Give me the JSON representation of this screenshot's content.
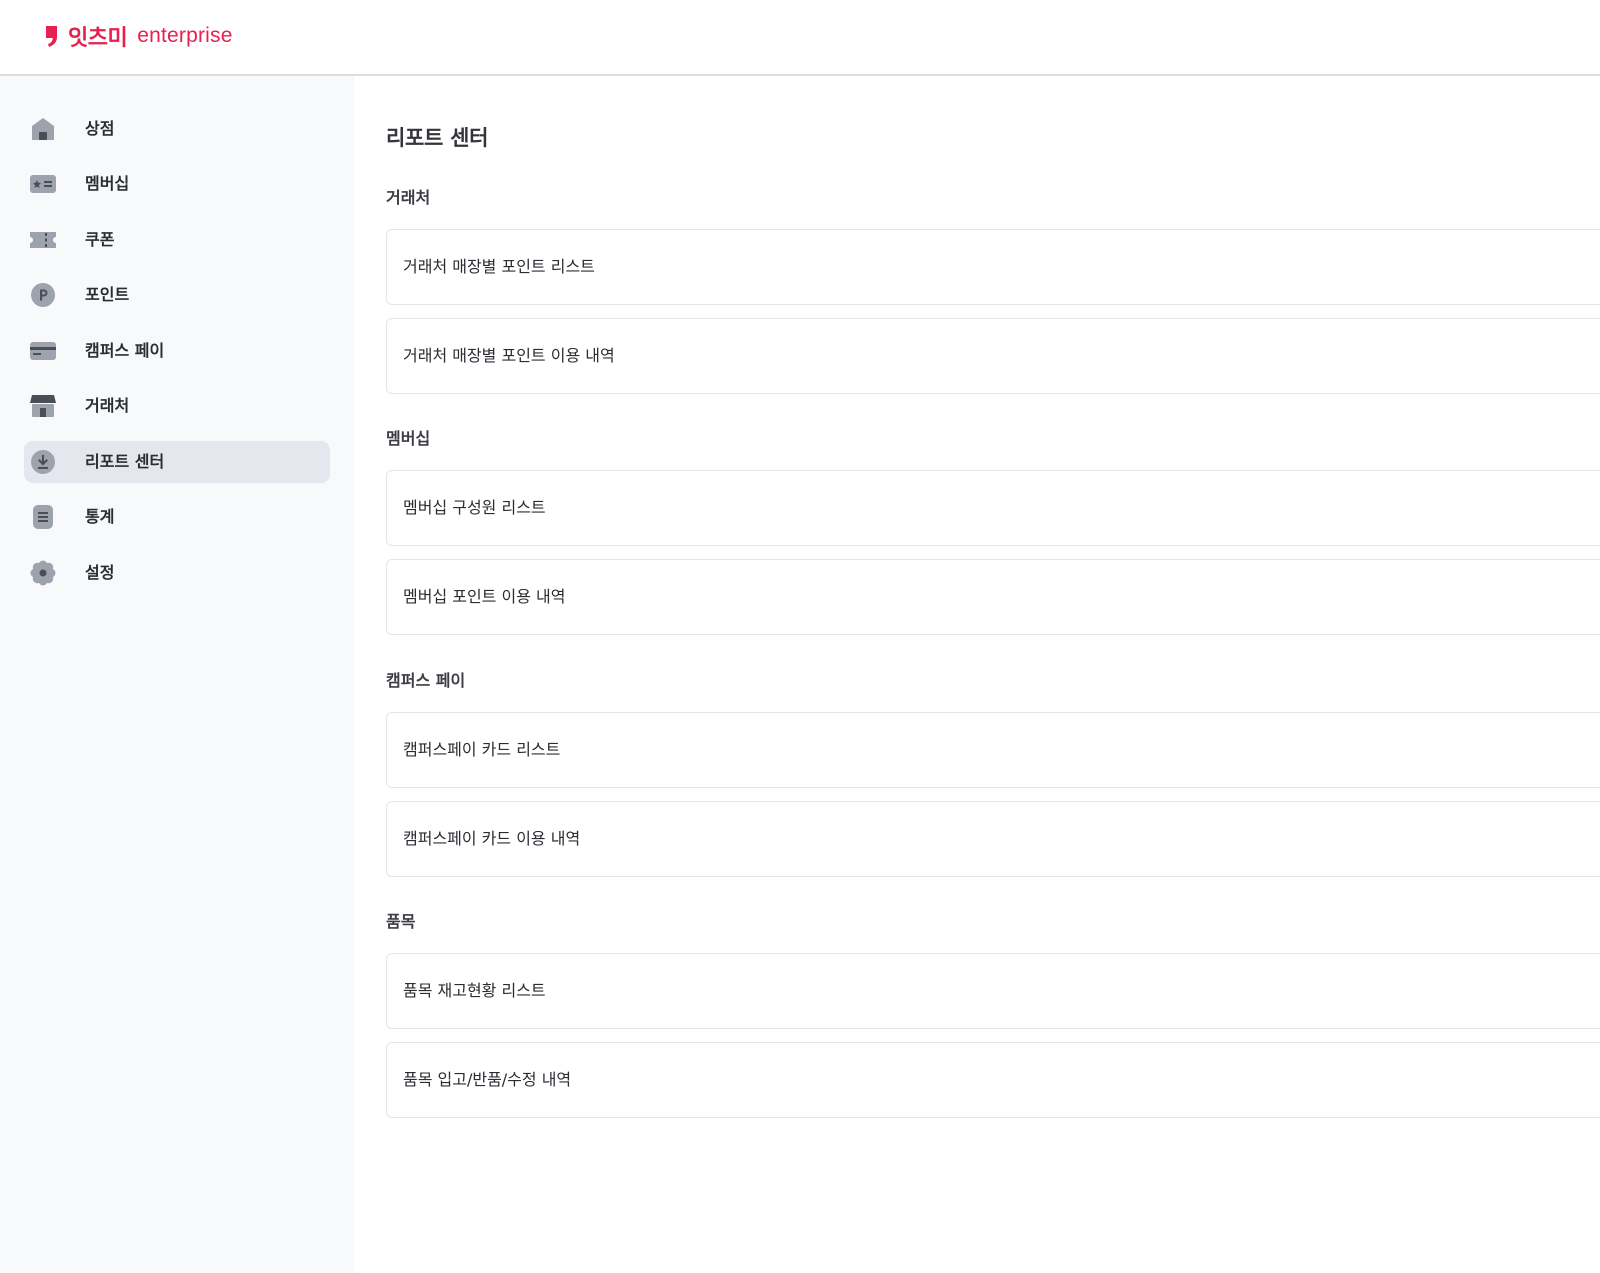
{
  "header": {
    "brand": "잇츠미",
    "brand_suffix": "enterprise",
    "accent_color": "#e8204f"
  },
  "sidebar": {
    "items": [
      {
        "label": "상점",
        "icon": "store-icon"
      },
      {
        "label": "멤버십",
        "icon": "membership-card-icon"
      },
      {
        "label": "쿠폰",
        "icon": "coupon-icon"
      },
      {
        "label": "포인트",
        "icon": "point-icon"
      },
      {
        "label": "캠퍼스 페이",
        "icon": "credit-card-icon"
      },
      {
        "label": "거래처",
        "icon": "shop-awning-icon"
      },
      {
        "label": "리포트 센터",
        "icon": "download-icon",
        "active": true
      },
      {
        "label": "통계",
        "icon": "document-list-icon"
      },
      {
        "label": "설정",
        "icon": "gear-icon"
      }
    ]
  },
  "main": {
    "title": "리포트 센터",
    "sections": [
      {
        "title": "거래처",
        "reports": [
          "거래처 매장별 포인트 리스트",
          "거래처 매장별 포인트 이용 내역"
        ]
      },
      {
        "title": "멤버십",
        "reports": [
          "멤버십 구성원 리스트",
          "멤버십 포인트 이용 내역"
        ]
      },
      {
        "title": "캠퍼스 페이",
        "reports": [
          "캠퍼스페이 카드 리스트",
          "캠퍼스페이 카드 이용 내역"
        ]
      },
      {
        "title": "품목",
        "reports": [
          "품목 재고현황 리스트",
          "품목 입고/반품/수정 내역"
        ]
      }
    ]
  }
}
